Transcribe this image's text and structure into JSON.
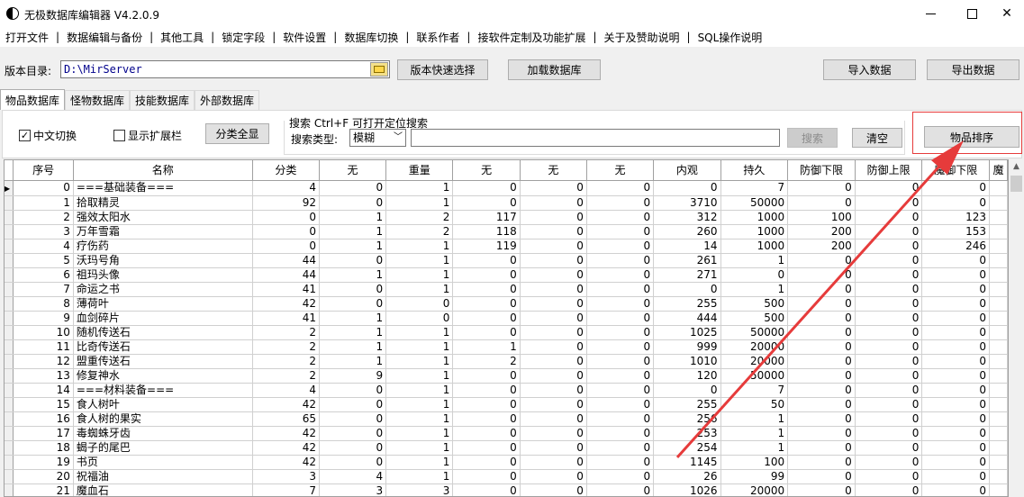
{
  "window": {
    "title": "无极数据库编辑器 V4.2.0.9"
  },
  "menu": [
    "打开文件",
    "数据编辑与备份",
    "其他工具",
    "锁定字段",
    "软件设置",
    "数据库切换",
    "联系作者",
    "接软件定制及功能扩展",
    "关于及赞助说明",
    "SQL操作说明"
  ],
  "toolbar": {
    "dir_label": "版本目录:",
    "dir_value": "D:\\MirServer",
    "version_select_label": "版本快速选择",
    "load_db_label": "加载数据库",
    "import_label": "导入数据",
    "export_label": "导出数据"
  },
  "tabs": [
    {
      "label": "物品数据库",
      "active": true
    },
    {
      "label": "怪物数据库",
      "active": false
    },
    {
      "label": "技能数据库",
      "active": false
    },
    {
      "label": "外部数据库",
      "active": false
    }
  ],
  "panel": {
    "chinese_toggle_label": "中文切换",
    "chinese_toggle_checked": true,
    "show_ext_label": "显示扩展栏",
    "show_ext_checked": false,
    "classify_all_label": "分类全显",
    "search_group_label": "搜索  Ctrl+F 可打开定位搜索",
    "search_type_label": "搜索类型:",
    "search_type_value": "模糊",
    "search_value": "",
    "search_button_label": "搜索",
    "clear_button_label": "清空",
    "sort_button_label": "物品排序"
  },
  "grid": {
    "columns": [
      "序号",
      "名称",
      "分类",
      "无",
      "重量",
      "无",
      "无",
      "无",
      "内观",
      "持久",
      "防御下限",
      "防御上限",
      "魔御下限",
      "魔"
    ],
    "rows": [
      [
        "0",
        "===基础装备===",
        "4",
        "0",
        "1",
        "0",
        "0",
        "0",
        "0",
        "7",
        "0",
        "0",
        "0"
      ],
      [
        "1",
        "拾取精灵",
        "92",
        "0",
        "1",
        "0",
        "0",
        "0",
        "3710",
        "50000",
        "0",
        "0",
        "0"
      ],
      [
        "2",
        "强效太阳水",
        "0",
        "1",
        "2",
        "117",
        "0",
        "0",
        "312",
        "1000",
        "100",
        "0",
        "123"
      ],
      [
        "3",
        "万年雪霜",
        "0",
        "1",
        "2",
        "118",
        "0",
        "0",
        "260",
        "1000",
        "200",
        "0",
        "153"
      ],
      [
        "4",
        "疗伤药",
        "0",
        "1",
        "1",
        "119",
        "0",
        "0",
        "14",
        "1000",
        "200",
        "0",
        "246"
      ],
      [
        "5",
        "沃玛号角",
        "44",
        "0",
        "1",
        "0",
        "0",
        "0",
        "261",
        "1",
        "0",
        "0",
        "0"
      ],
      [
        "6",
        "祖玛头像",
        "44",
        "1",
        "1",
        "0",
        "0",
        "0",
        "271",
        "0",
        "0",
        "0",
        "0"
      ],
      [
        "7",
        "命运之书",
        "41",
        "0",
        "1",
        "0",
        "0",
        "0",
        "0",
        "1",
        "0",
        "0",
        "0"
      ],
      [
        "8",
        "薄荷叶",
        "42",
        "0",
        "0",
        "0",
        "0",
        "0",
        "255",
        "500",
        "0",
        "0",
        "0"
      ],
      [
        "9",
        "血剑碎片",
        "41",
        "1",
        "0",
        "0",
        "0",
        "0",
        "444",
        "500",
        "0",
        "0",
        "0"
      ],
      [
        "10",
        "随机传送石",
        "2",
        "1",
        "1",
        "0",
        "0",
        "0",
        "1025",
        "50000",
        "0",
        "0",
        "0"
      ],
      [
        "11",
        "比奇传送石",
        "2",
        "1",
        "1",
        "1",
        "0",
        "0",
        "999",
        "20000",
        "0",
        "0",
        "0"
      ],
      [
        "12",
        "盟重传送石",
        "2",
        "1",
        "1",
        "2",
        "0",
        "0",
        "1010",
        "20000",
        "0",
        "0",
        "0"
      ],
      [
        "13",
        "修复神水",
        "2",
        "9",
        "1",
        "0",
        "0",
        "0",
        "120",
        "50000",
        "0",
        "0",
        "0"
      ],
      [
        "14",
        "===材料装备===",
        "4",
        "0",
        "1",
        "0",
        "0",
        "0",
        "0",
        "7",
        "0",
        "0",
        "0"
      ],
      [
        "15",
        "食人树叶",
        "42",
        "0",
        "1",
        "0",
        "0",
        "0",
        "255",
        "50",
        "0",
        "0",
        "0"
      ],
      [
        "16",
        "食人树的果实",
        "65",
        "0",
        "1",
        "0",
        "0",
        "0",
        "256",
        "1",
        "0",
        "0",
        "0"
      ],
      [
        "17",
        "毒蜘蛛牙齿",
        "42",
        "0",
        "1",
        "0",
        "0",
        "0",
        "253",
        "1",
        "0",
        "0",
        "0"
      ],
      [
        "18",
        "蝎子的尾巴",
        "42",
        "0",
        "1",
        "0",
        "0",
        "0",
        "254",
        "1",
        "0",
        "0",
        "0"
      ],
      [
        "19",
        "书页",
        "42",
        "0",
        "1",
        "0",
        "0",
        "0",
        "1145",
        "100",
        "0",
        "0",
        "0"
      ],
      [
        "20",
        "祝福油",
        "3",
        "4",
        "1",
        "0",
        "0",
        "0",
        "26",
        "99",
        "0",
        "0",
        "0"
      ],
      [
        "21",
        "魔血石",
        "7",
        "3",
        "3",
        "0",
        "0",
        "0",
        "1026",
        "20000",
        "0",
        "0",
        "0"
      ]
    ]
  },
  "colors": {
    "annotation_red": "#e63b3b"
  }
}
